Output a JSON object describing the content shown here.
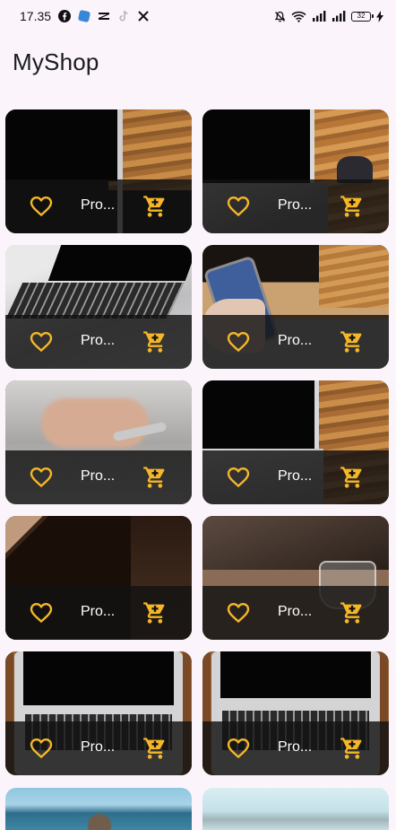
{
  "status_bar": {
    "time": "17.35",
    "battery_level": "32",
    "app_icons": [
      "facebook-icon",
      "messenger-icon",
      "capcut-icon",
      "tiktok-icon",
      "x-icon"
    ],
    "system_icons": [
      "bell-muted-icon",
      "wifi-icon",
      "signal-icon",
      "signal-icon",
      "battery-icon",
      "charging-icon"
    ]
  },
  "app": {
    "title": "MyShop"
  },
  "colors": {
    "accent": "#f5b727",
    "background": "#fbf5fb",
    "overlay": "#121212"
  },
  "products": [
    {
      "name": "Pro..."
    },
    {
      "name": "Pro..."
    },
    {
      "name": "Pro..."
    },
    {
      "name": "Pro..."
    },
    {
      "name": "Pro..."
    },
    {
      "name": "Pro..."
    },
    {
      "name": "Pro..."
    },
    {
      "name": "Pro..."
    },
    {
      "name": "Pro..."
    },
    {
      "name": "Pro..."
    }
  ]
}
